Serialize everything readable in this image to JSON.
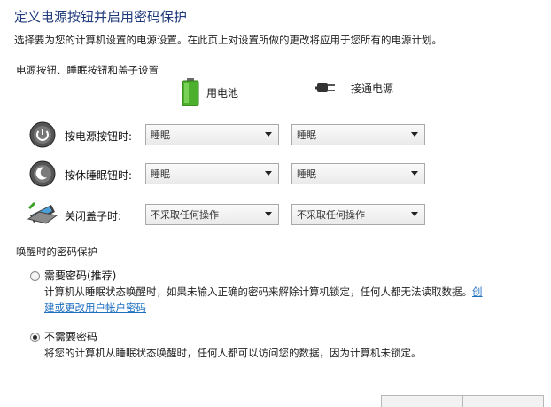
{
  "header": {
    "title": "定义电源按钮并启用密码保护",
    "description": "选择要为您的计算机设置的电源设置。在此页上对设置所做的更改将应用于您所有的电源计划。"
  },
  "buttons_section": {
    "heading": "电源按钮、睡眠按钮和盖子设置",
    "col_battery": "用电池",
    "col_plugged": "接通电源",
    "rows": [
      {
        "label": "按电源按钮时:",
        "battery": "睡眠",
        "plugged": "睡眠"
      },
      {
        "label": "按休睡眠钮时:",
        "battery": "睡眠",
        "plugged": "睡眠"
      },
      {
        "label": "关闭盖子时:",
        "battery": "不采取任何操作",
        "plugged": "不采取任何操作"
      }
    ]
  },
  "password_section": {
    "heading": "唤醒时的密码保护",
    "options": [
      {
        "label": "需要密码(推荐)",
        "desc": "计算机从睡眠状态唤醒时，如果未输入正确的密码来解除计算机锁定，任何人都无法读取数据。",
        "link_a": "创",
        "link_b": "建或更改用户帐户密码",
        "selected": false
      },
      {
        "label": "不需要密码",
        "desc": "将您的计算机从睡眠状态唤醒时，任何人都可以访问您的数据，因为计算机未锁定。",
        "selected": true
      }
    ]
  },
  "colors": {
    "title": "#1f3a7a",
    "link": "#1e6fc0"
  }
}
